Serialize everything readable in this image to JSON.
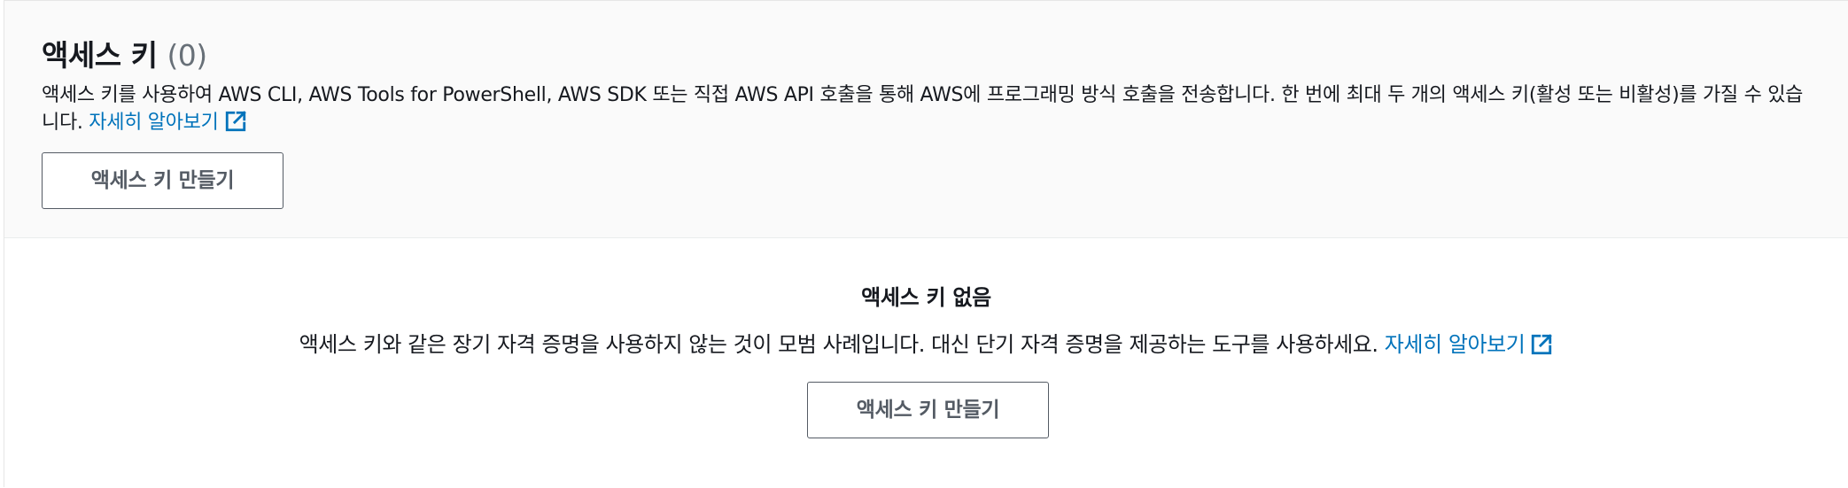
{
  "section": {
    "title": "액세스 키",
    "count": "(0)",
    "description": "액세스 키를 사용하여 AWS CLI, AWS Tools for PowerShell, AWS SDK 또는 직접 AWS API 호출을 통해 AWS에 프로그래밍 방식 호출을 전송합니다. 한 번에 최대 두 개의 액세스 키(활성 또는 비활성)를 가질 수 있습니다.",
    "learn_more_label": "자세히 알아보기",
    "create_button_label": "액세스 키 만들기"
  },
  "empty_state": {
    "title": "액세스 키 없음",
    "description": "액세스 키와 같은 장기 자격 증명을 사용하지 않는 것이 모범 사례입니다. 대신 단기 자격 증명을 제공하는 도구를 사용하세요.",
    "learn_more_label": "자세히 알아보기",
    "create_button_label": "액세스 키 만들기"
  },
  "colors": {
    "link": "#0073bb",
    "button_border": "#545b64",
    "header_background": "#fafafa",
    "count_text": "#687078"
  },
  "icons": {
    "external_link": "external-link-icon"
  }
}
